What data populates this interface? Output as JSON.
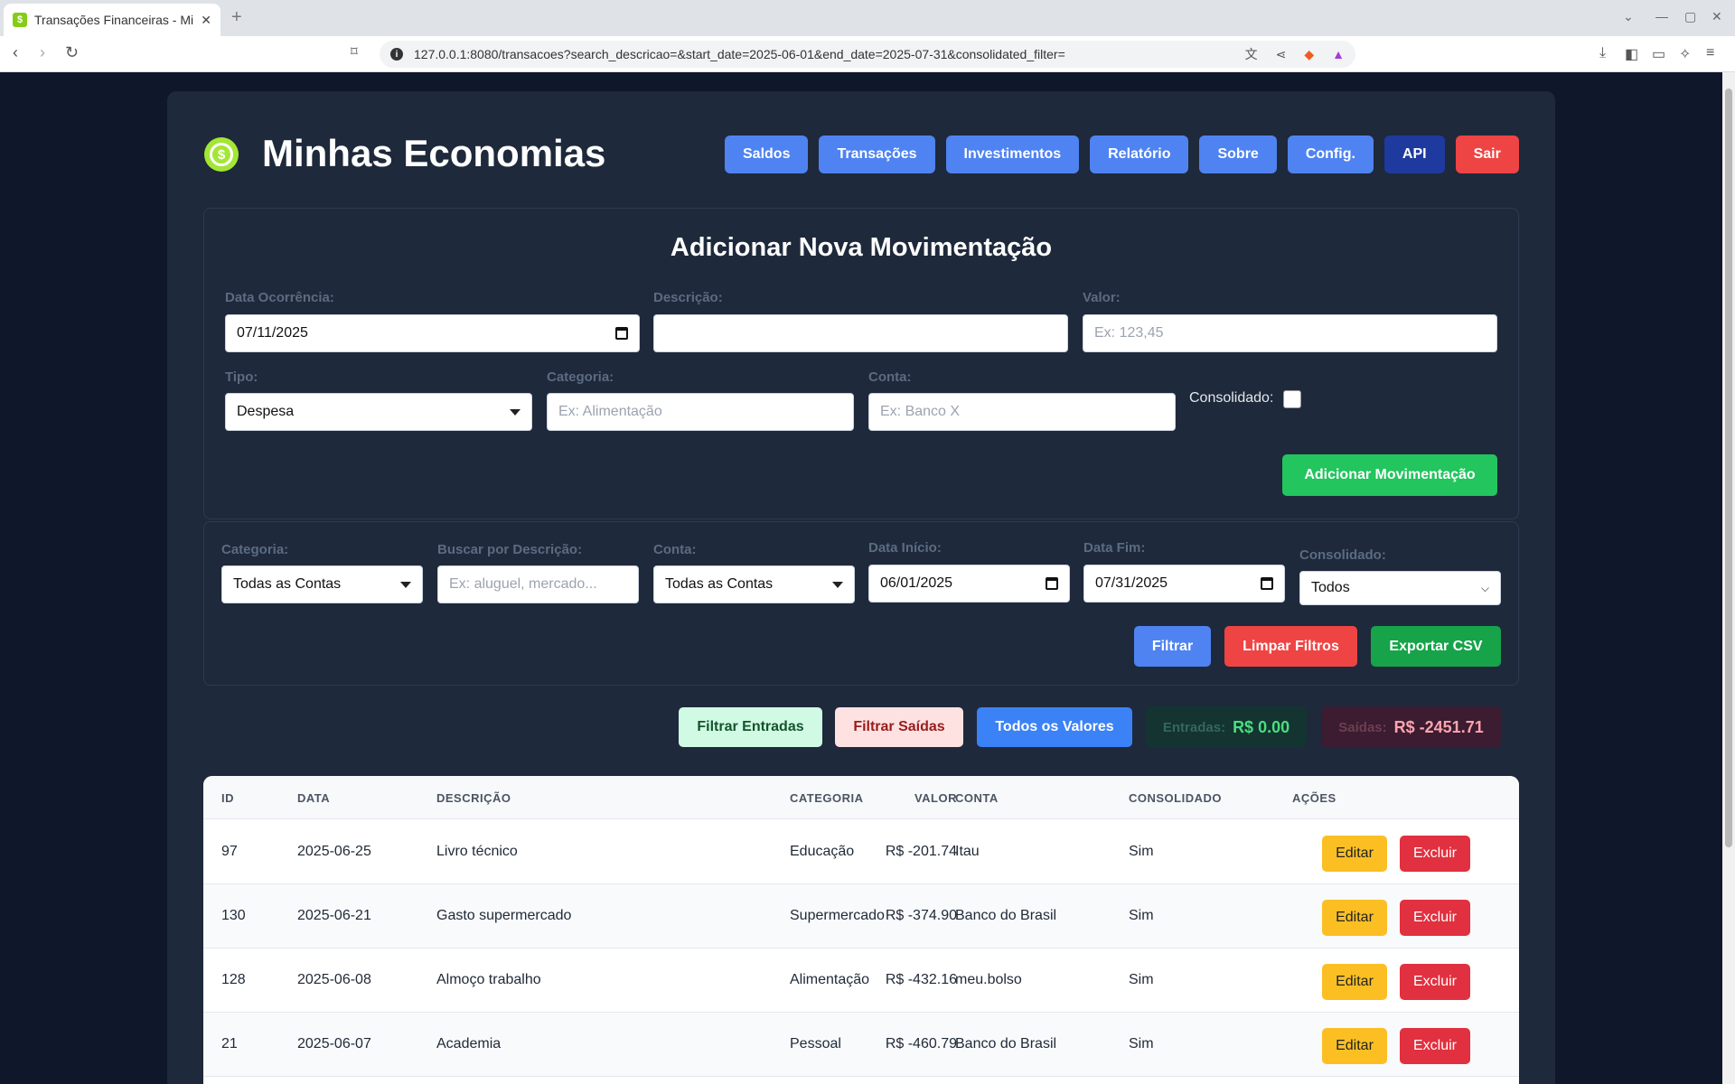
{
  "browser": {
    "tab_title": "Transações Financeiras - Mi",
    "tab_favicon": "$",
    "url": "127.0.0.1:8080/transacoes?search_descricao=&start_date=2025-06-01&end_date=2025-07-31&consolidated_filter="
  },
  "app": {
    "title": "Minhas Economias",
    "logo_glyph": "$"
  },
  "nav": {
    "saldos": "Saldos",
    "transacoes": "Transações",
    "investimentos": "Investimentos",
    "relatorio": "Relatório",
    "sobre": "Sobre",
    "config": "Config.",
    "api": "API",
    "sair": "Sair"
  },
  "form": {
    "title": "Adicionar Nova Movimentação",
    "data_label": "Data Ocorrência:",
    "data_value": "07/11/2025",
    "descricao_label": "Descrição:",
    "descricao_value": "",
    "valor_label": "Valor:",
    "valor_placeholder": "Ex: 123,45",
    "tipo_label": "Tipo:",
    "tipo_value": "Despesa",
    "categoria_label": "Categoria:",
    "categoria_placeholder": "Ex: Alimentação",
    "conta_label": "Conta:",
    "conta_placeholder": "Ex: Banco X",
    "consolidado_label": "Consolidado:",
    "consolidado_checked": false,
    "submit": "Adicionar Movimentação"
  },
  "filters": {
    "categoria_label": "Categoria:",
    "categoria_value": "Todas as Contas",
    "busca_label": "Buscar por Descrição:",
    "busca_placeholder": "Ex: aluguel, mercado...",
    "conta_label": "Conta:",
    "conta_value": "Todas as Contas",
    "inicio_label": "Data Início:",
    "inicio_value": "06/01/2025",
    "fim_label": "Data Fim:",
    "fim_value": "07/31/2025",
    "consolidado_label": "Consolidado:",
    "consolidado_value": "Todos",
    "filtrar": "Filtrar",
    "limpar": "Limpar Filtros",
    "exportar": "Exportar CSV"
  },
  "quick": {
    "entradas_btn": "Filtrar Entradas",
    "saidas_btn": "Filtrar Saídas",
    "todos_btn": "Todos os Valores",
    "entradas_label": "Entradas:",
    "entradas_value": "R$ 0.00",
    "saidas_label": "Saídas:",
    "saidas_value": "R$ -2451.71"
  },
  "table": {
    "headers": [
      "ID",
      "DATA",
      "DESCRIÇÃO",
      "VALOR",
      "CATEGORIA",
      "CONTA",
      "CONSOLIDADO",
      "AÇÕES"
    ],
    "edit_label": "Editar",
    "delete_label": "Excluir",
    "rows": [
      {
        "id": "97",
        "data": "2025-06-25",
        "descricao": "Livro técnico",
        "valor": "R$ -201.74",
        "categoria": "Educação",
        "conta": "Itau",
        "consolidado": "Sim"
      },
      {
        "id": "130",
        "data": "2025-06-21",
        "descricao": "Gasto supermercado",
        "valor": "R$ -374.90",
        "categoria": "Supermercado",
        "conta": "Banco do Brasil",
        "consolidado": "Sim"
      },
      {
        "id": "128",
        "data": "2025-06-08",
        "descricao": "Almoço trabalho",
        "valor": "R$ -432.16",
        "categoria": "Alimentação",
        "conta": "meu.bolso",
        "consolidado": "Sim"
      },
      {
        "id": "21",
        "data": "2025-06-07",
        "descricao": "Academia",
        "valor": "R$ -460.79",
        "categoria": "Pessoal",
        "conta": "Banco do Brasil",
        "consolidado": "Sim"
      }
    ]
  },
  "colors": {
    "background": "#0f172a",
    "card": "#1e293b",
    "primary": "#4f83f1",
    "danger": "#ef4444",
    "success": "#22c55e",
    "warning": "#fbbf24"
  }
}
